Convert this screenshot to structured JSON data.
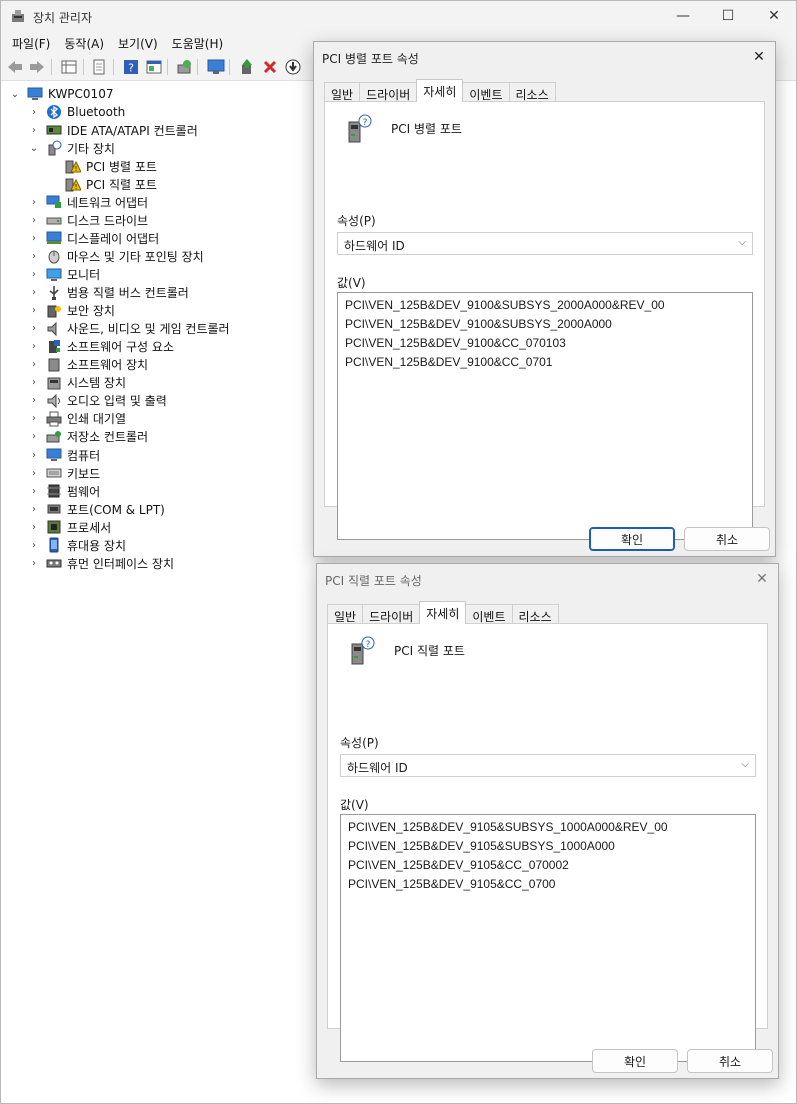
{
  "main": {
    "title": "장치 관리자",
    "window_controls": {
      "minimize": "—",
      "maximize": "☐",
      "close": "✕"
    },
    "menu": [
      "파일(F)",
      "동작(A)",
      "보기(V)",
      "도움말(H)"
    ],
    "tree": {
      "root": "KWPC0107",
      "items": [
        {
          "label": "Bluetooth",
          "icon": "bluetooth-icon",
          "expanded": false
        },
        {
          "label": "IDE ATA/ATAPI 컨트롤러",
          "icon": "controller-icon",
          "expanded": false
        },
        {
          "label": "기타 장치",
          "icon": "unknown-device-icon",
          "expanded": true
        },
        {
          "label": "네트워크 어댑터",
          "icon": "network-adapter-icon",
          "expanded": false
        },
        {
          "label": "디스크 드라이브",
          "icon": "disk-drive-icon",
          "expanded": false
        },
        {
          "label": "디스플레이 어댑터",
          "icon": "display-adapter-icon",
          "expanded": false
        },
        {
          "label": "마우스 및 기타 포인팅 장치",
          "icon": "mouse-icon",
          "expanded": false
        },
        {
          "label": "모니터",
          "icon": "monitor-icon",
          "expanded": false
        },
        {
          "label": "범용 직렬 버스 컨트롤러",
          "icon": "usb-icon",
          "expanded": false
        },
        {
          "label": "보안 장치",
          "icon": "security-key-icon",
          "expanded": false
        },
        {
          "label": "사운드, 비디오 및 게임 컨트롤러",
          "icon": "speaker-icon",
          "expanded": false
        },
        {
          "label": "소프트웨어 구성 요소",
          "icon": "software-component-icon",
          "expanded": false
        },
        {
          "label": "소프트웨어 장치",
          "icon": "software-device-icon",
          "expanded": false
        },
        {
          "label": "시스템 장치",
          "icon": "system-device-icon",
          "expanded": false
        },
        {
          "label": "오디오 입력 및 출력",
          "icon": "audio-icon",
          "expanded": false
        },
        {
          "label": "인쇄 대기열",
          "icon": "printer-icon",
          "expanded": false
        },
        {
          "label": "저장소 컨트롤러",
          "icon": "storage-controller-icon",
          "expanded": false
        },
        {
          "label": "컴퓨터",
          "icon": "computer-icon",
          "expanded": false
        },
        {
          "label": "키보드",
          "icon": "keyboard-icon",
          "expanded": false
        },
        {
          "label": "펌웨어",
          "icon": "firmware-icon",
          "expanded": false
        },
        {
          "label": "포트(COM & LPT)",
          "icon": "port-icon",
          "expanded": false
        },
        {
          "label": "프로세서",
          "icon": "processor-icon",
          "expanded": false
        },
        {
          "label": "휴대용 장치",
          "icon": "portable-device-icon",
          "expanded": false
        },
        {
          "label": "휴먼 인터페이스 장치",
          "icon": "hid-icon",
          "expanded": false
        }
      ],
      "children_of_other": [
        {
          "label": "PCI 병렬 포트",
          "icon": "warning-device-icon"
        },
        {
          "label": "PCI 직렬 포트",
          "icon": "warning-device-icon"
        }
      ]
    }
  },
  "dialogs": [
    {
      "title": "PCI 병렬 포트 속성",
      "tabs": [
        "일반",
        "드라이버",
        "자세히",
        "이벤트",
        "리소스"
      ],
      "active_tab": "자세히",
      "device_name": "PCI 병렬 포트",
      "property_label": "속성(P)",
      "property_value": "하드웨어 ID",
      "value_label": "값(V)",
      "values": [
        "PCI\\VEN_125B&DEV_9100&SUBSYS_2000A000&REV_00",
        "PCI\\VEN_125B&DEV_9100&SUBSYS_2000A000",
        "PCI\\VEN_125B&DEV_9100&CC_070103",
        "PCI\\VEN_125B&DEV_9100&CC_0701"
      ],
      "ok_label": "확인",
      "cancel_label": "취소"
    },
    {
      "title": "PCI 직렬 포트 속성",
      "tabs": [
        "일반",
        "드라이버",
        "자세히",
        "이벤트",
        "리소스"
      ],
      "active_tab": "자세히",
      "device_name": "PCI 직렬 포트",
      "property_label": "속성(P)",
      "property_value": "하드웨어 ID",
      "value_label": "값(V)",
      "values": [
        "PCI\\VEN_125B&DEV_9105&SUBSYS_1000A000&REV_00",
        "PCI\\VEN_125B&DEV_9105&SUBSYS_1000A000",
        "PCI\\VEN_125B&DEV_9105&CC_070002",
        "PCI\\VEN_125B&DEV_9105&CC_0700"
      ],
      "ok_label": "확인",
      "cancel_label": "취소"
    }
  ],
  "colors": {
    "accent": "#1a5fb4",
    "warning": "#f2c200",
    "error": "#d12a2a",
    "toolbar_bg": "#f3f3f3",
    "dialog_bg": "#f0f0f0"
  }
}
